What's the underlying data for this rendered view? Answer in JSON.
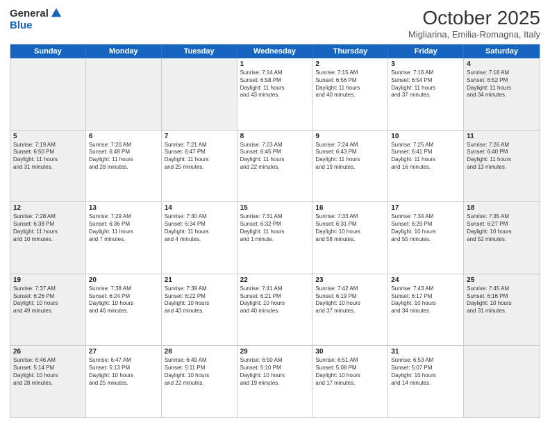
{
  "header": {
    "logo_general": "General",
    "logo_blue": "Blue",
    "title": "October 2025",
    "location": "Migliarina, Emilia-Romagna, Italy"
  },
  "weekdays": [
    "Sunday",
    "Monday",
    "Tuesday",
    "Wednesday",
    "Thursday",
    "Friday",
    "Saturday"
  ],
  "rows": [
    [
      {
        "day": "",
        "info": "",
        "shaded": true
      },
      {
        "day": "",
        "info": "",
        "shaded": true
      },
      {
        "day": "",
        "info": "",
        "shaded": true
      },
      {
        "day": "1",
        "info": "Sunrise: 7:14 AM\nSunset: 6:58 PM\nDaylight: 11 hours\nand 43 minutes.",
        "shaded": false
      },
      {
        "day": "2",
        "info": "Sunrise: 7:15 AM\nSunset: 6:56 PM\nDaylight: 11 hours\nand 40 minutes.",
        "shaded": false
      },
      {
        "day": "3",
        "info": "Sunrise: 7:16 AM\nSunset: 6:54 PM\nDaylight: 11 hours\nand 37 minutes.",
        "shaded": false
      },
      {
        "day": "4",
        "info": "Sunrise: 7:18 AM\nSunset: 6:52 PM\nDaylight: 11 hours\nand 34 minutes.",
        "shaded": true
      }
    ],
    [
      {
        "day": "5",
        "info": "Sunrise: 7:19 AM\nSunset: 6:50 PM\nDaylight: 11 hours\nand 31 minutes.",
        "shaded": true
      },
      {
        "day": "6",
        "info": "Sunrise: 7:20 AM\nSunset: 6:49 PM\nDaylight: 11 hours\nand 28 minutes.",
        "shaded": false
      },
      {
        "day": "7",
        "info": "Sunrise: 7:21 AM\nSunset: 6:47 PM\nDaylight: 11 hours\nand 25 minutes.",
        "shaded": false
      },
      {
        "day": "8",
        "info": "Sunrise: 7:23 AM\nSunset: 6:45 PM\nDaylight: 11 hours\nand 22 minutes.",
        "shaded": false
      },
      {
        "day": "9",
        "info": "Sunrise: 7:24 AM\nSunset: 6:43 PM\nDaylight: 11 hours\nand 19 minutes.",
        "shaded": false
      },
      {
        "day": "10",
        "info": "Sunrise: 7:25 AM\nSunset: 6:41 PM\nDaylight: 11 hours\nand 16 minutes.",
        "shaded": false
      },
      {
        "day": "11",
        "info": "Sunrise: 7:26 AM\nSunset: 6:40 PM\nDaylight: 11 hours\nand 13 minutes.",
        "shaded": true
      }
    ],
    [
      {
        "day": "12",
        "info": "Sunrise: 7:28 AM\nSunset: 6:38 PM\nDaylight: 11 hours\nand 10 minutes.",
        "shaded": true
      },
      {
        "day": "13",
        "info": "Sunrise: 7:29 AM\nSunset: 6:36 PM\nDaylight: 11 hours\nand 7 minutes.",
        "shaded": false
      },
      {
        "day": "14",
        "info": "Sunrise: 7:30 AM\nSunset: 6:34 PM\nDaylight: 11 hours\nand 4 minutes.",
        "shaded": false
      },
      {
        "day": "15",
        "info": "Sunrise: 7:31 AM\nSunset: 6:32 PM\nDaylight: 11 hours\nand 1 minute.",
        "shaded": false
      },
      {
        "day": "16",
        "info": "Sunrise: 7:33 AM\nSunset: 6:31 PM\nDaylight: 10 hours\nand 58 minutes.",
        "shaded": false
      },
      {
        "day": "17",
        "info": "Sunrise: 7:34 AM\nSunset: 6:29 PM\nDaylight: 10 hours\nand 55 minutes.",
        "shaded": false
      },
      {
        "day": "18",
        "info": "Sunrise: 7:35 AM\nSunset: 6:27 PM\nDaylight: 10 hours\nand 52 minutes.",
        "shaded": true
      }
    ],
    [
      {
        "day": "19",
        "info": "Sunrise: 7:37 AM\nSunset: 6:26 PM\nDaylight: 10 hours\nand 49 minutes.",
        "shaded": true
      },
      {
        "day": "20",
        "info": "Sunrise: 7:38 AM\nSunset: 6:24 PM\nDaylight: 10 hours\nand 46 minutes.",
        "shaded": false
      },
      {
        "day": "21",
        "info": "Sunrise: 7:39 AM\nSunset: 6:22 PM\nDaylight: 10 hours\nand 43 minutes.",
        "shaded": false
      },
      {
        "day": "22",
        "info": "Sunrise: 7:41 AM\nSunset: 6:21 PM\nDaylight: 10 hours\nand 40 minutes.",
        "shaded": false
      },
      {
        "day": "23",
        "info": "Sunrise: 7:42 AM\nSunset: 6:19 PM\nDaylight: 10 hours\nand 37 minutes.",
        "shaded": false
      },
      {
        "day": "24",
        "info": "Sunrise: 7:43 AM\nSunset: 6:17 PM\nDaylight: 10 hours\nand 34 minutes.",
        "shaded": false
      },
      {
        "day": "25",
        "info": "Sunrise: 7:45 AM\nSunset: 6:16 PM\nDaylight: 10 hours\nand 31 minutes.",
        "shaded": true
      }
    ],
    [
      {
        "day": "26",
        "info": "Sunrise: 6:46 AM\nSunset: 5:14 PM\nDaylight: 10 hours\nand 28 minutes.",
        "shaded": true
      },
      {
        "day": "27",
        "info": "Sunrise: 6:47 AM\nSunset: 5:13 PM\nDaylight: 10 hours\nand 25 minutes.",
        "shaded": false
      },
      {
        "day": "28",
        "info": "Sunrise: 6:49 AM\nSunset: 5:11 PM\nDaylight: 10 hours\nand 22 minutes.",
        "shaded": false
      },
      {
        "day": "29",
        "info": "Sunrise: 6:50 AM\nSunset: 5:10 PM\nDaylight: 10 hours\nand 19 minutes.",
        "shaded": false
      },
      {
        "day": "30",
        "info": "Sunrise: 6:51 AM\nSunset: 5:08 PM\nDaylight: 10 hours\nand 17 minutes.",
        "shaded": false
      },
      {
        "day": "31",
        "info": "Sunrise: 6:53 AM\nSunset: 5:07 PM\nDaylight: 10 hours\nand 14 minutes.",
        "shaded": false
      },
      {
        "day": "",
        "info": "",
        "shaded": true
      }
    ]
  ]
}
